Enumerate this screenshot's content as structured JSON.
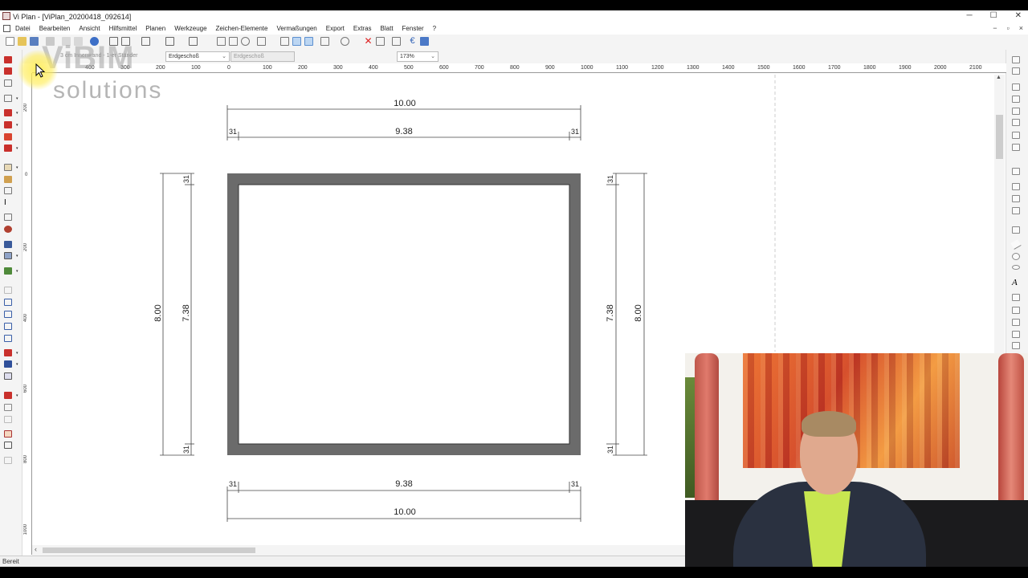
{
  "window": {
    "title": "Vi Plan - [ViPlan_20200418_092614]",
    "min_glyph": "─",
    "max_glyph": "☐",
    "close_glyph": "✕"
  },
  "menu": {
    "items": [
      "Datei",
      "Bearbeiten",
      "Ansicht",
      "Hilfsmittel",
      "Planen",
      "Werkzeuge",
      "Zeichen-Elemente",
      "Vermaßungen",
      "Export",
      "Extras",
      "Blatt",
      "Fenster",
      "?"
    ],
    "mdi_min": "−",
    "mdi_restore": "▫",
    "mdi_close": "×"
  },
  "toolbar2": {
    "layer_label": "3 cm Innenwand - 1-er Ständer",
    "floor_combo": "Erdgeschoß",
    "floor_combo_disabled": "Erdgeschoß",
    "zoom_combo": "173%"
  },
  "ruler_top": {
    "ticks": [
      "400",
      "300",
      "200",
      "100",
      "0",
      "100",
      "200",
      "300",
      "400",
      "500",
      "600",
      "700",
      "800",
      "900",
      "1000",
      "1100",
      "1200",
      "1300",
      "1400",
      "1500",
      "1600",
      "1700",
      "1800",
      "1900",
      "2000",
      "2100"
    ]
  },
  "ruler_left": {
    "ticks": [
      "200",
      "0",
      "200",
      "400",
      "600",
      "800",
      "1000"
    ]
  },
  "watermark": {
    "logo": "ViBIM",
    "subtitle": "solutions"
  },
  "plan": {
    "top_overall": "10.00",
    "top_inner": "9.38",
    "top_left_wall": "31",
    "top_right_wall": "31",
    "bottom_overall": "10.00",
    "bottom_inner": "9.38",
    "bottom_left_wall": "31",
    "bottom_right_wall": "31",
    "left_overall": "8.00",
    "left_inner": "7.38",
    "left_top_wall": "31",
    "left_bottom_wall": "31",
    "right_overall": "8.00",
    "right_inner": "7.38",
    "right_top_wall": "31",
    "right_bottom_wall": "31"
  },
  "status": {
    "text": "Bereit"
  },
  "colors": {
    "wall_fill": "#6b6b6b",
    "toolbar_bg": "#f4f4f4"
  }
}
